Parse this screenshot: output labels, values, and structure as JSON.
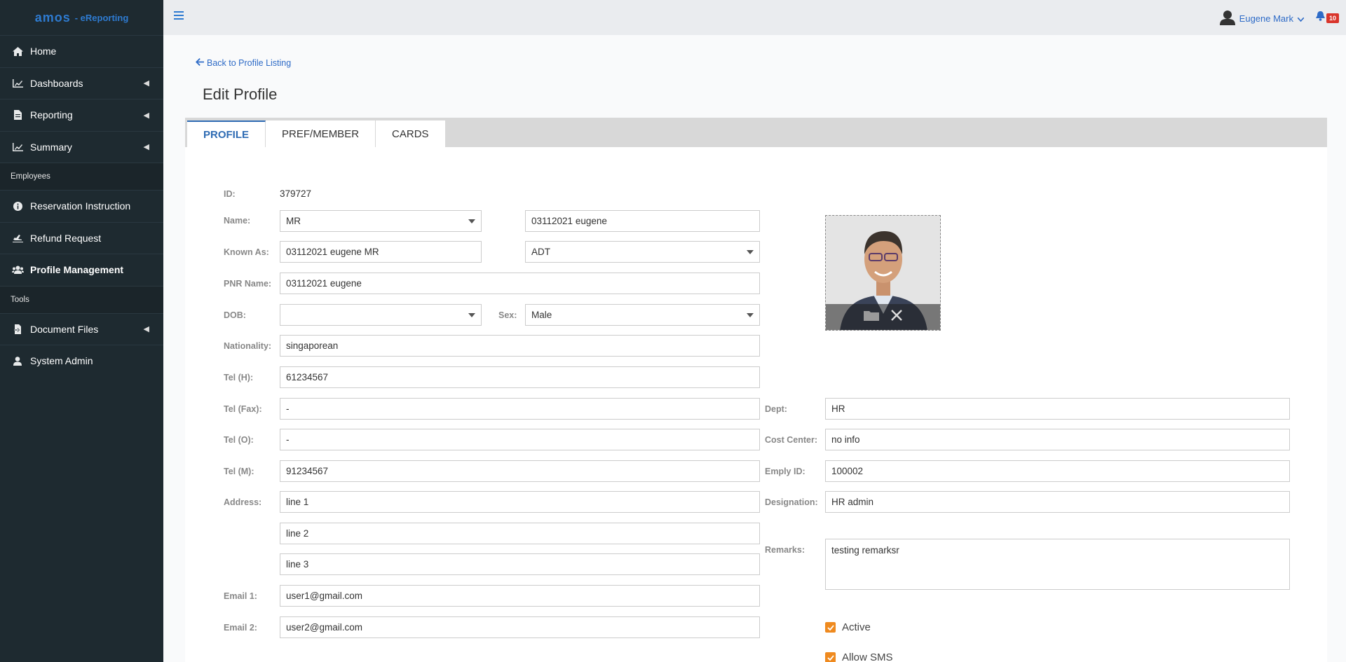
{
  "app": {
    "logo_main": "amos",
    "logo_sub": "- eReporting"
  },
  "sidebar": {
    "items": [
      {
        "label": "Home",
        "icon": "home-icon"
      },
      {
        "label": "Dashboards",
        "icon": "chart-icon"
      },
      {
        "label": "Reporting",
        "icon": "document-icon"
      },
      {
        "label": "Summary",
        "icon": "chart-icon"
      }
    ],
    "section_employees": "Employees",
    "employee_items": [
      {
        "label": "Reservation Instruction",
        "icon": "info-icon"
      },
      {
        "label": "Refund Request",
        "icon": "plane-icon"
      },
      {
        "label": "Profile Management",
        "icon": "users-icon"
      }
    ],
    "section_tools": "Tools",
    "tool_items": [
      {
        "label": "Document Files",
        "icon": "file-export-icon"
      },
      {
        "label": "System Admin",
        "icon": "user-icon"
      }
    ]
  },
  "topbar": {
    "user_name": "Eugene Mark",
    "notification_count": "10"
  },
  "page": {
    "back_link": "Back to Profile Listing",
    "title": "Edit Profile"
  },
  "tabs": [
    "PROFILE",
    "PREF/MEMBER",
    "CARDS"
  ],
  "labels": {
    "id": "ID:",
    "name": "Name:",
    "known_as": "Known As:",
    "pnr_name": "PNR Name:",
    "dob": "DOB:",
    "sex": "Sex:",
    "nationality": "Nationality:",
    "tel_h": "Tel (H):",
    "tel_fax": "Tel (Fax):",
    "tel_o": "Tel (O):",
    "tel_m": "Tel (M):",
    "address": "Address:",
    "email1": "Email 1:",
    "email2": "Email 2:",
    "dept": "Dept:",
    "cost_center": "Cost Center:",
    "emply_id": "Emply ID:",
    "designation": "Designation:",
    "remarks": "Remarks:"
  },
  "form": {
    "id": "379727",
    "title_select": "MR",
    "name": "03112021 eugene",
    "known_as": "03112021 eugene MR",
    "pax_type": "ADT",
    "pnr_name": "03112021 eugene",
    "dob": "",
    "sex": "Male",
    "nationality": "singaporean",
    "tel_h": "61234567",
    "tel_fax": "-",
    "tel_o": "-",
    "tel_m": "91234567",
    "address1": "line 1",
    "address2": "line 2",
    "address3": "line 3",
    "email1": "user1@gmail.com",
    "email2": "user2@gmail.com",
    "dept": "HR",
    "cost_center": "no info",
    "emply_id": "100002",
    "designation": "HR admin",
    "remarks": "testing remarksr"
  },
  "checkboxes": {
    "active": "Active",
    "allow_sms": "Allow SMS"
  },
  "colors": {
    "sidebar_bg": "#1e2a30",
    "accent": "#2e6bb3",
    "checkbox": "#ef8a1f",
    "badge": "#d9352b"
  }
}
